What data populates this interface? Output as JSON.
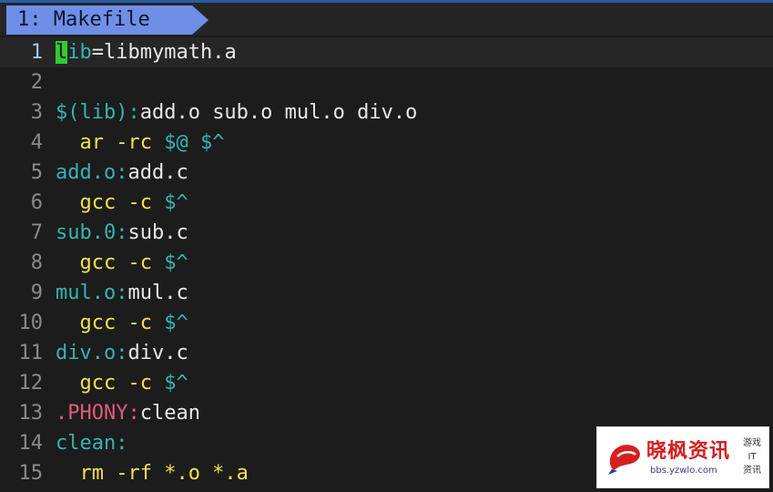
{
  "tab": {
    "label": "1: Makefile"
  },
  "colors": {
    "tab_active": "#6f8fe6",
    "cursor": "#2fcc2f",
    "target": "#36b3b3",
    "command": "#f2e24a",
    "phony": "#e05a7a",
    "default_text": "#e8e8e8"
  },
  "lines": [
    {
      "num": "1",
      "segments": [
        {
          "t": "l",
          "c": "cursor"
        },
        {
          "t": "ib",
          "c": "target"
        },
        {
          "t": "=libmymath.a",
          "c": "default"
        }
      ]
    },
    {
      "num": "2",
      "segments": []
    },
    {
      "num": "3",
      "segments": [
        {
          "t": "$(lib):",
          "c": "target"
        },
        {
          "t": "add.o sub.o mul.o div.o",
          "c": "default"
        }
      ]
    },
    {
      "num": "4",
      "segments": [
        {
          "t": "  ar -rc ",
          "c": "cmd"
        },
        {
          "t": "$@ $^",
          "c": "auto"
        }
      ]
    },
    {
      "num": "5",
      "segments": [
        {
          "t": "add.o:",
          "c": "target"
        },
        {
          "t": "add.c",
          "c": "default"
        }
      ]
    },
    {
      "num": "6",
      "segments": [
        {
          "t": "  gcc -c ",
          "c": "cmd"
        },
        {
          "t": "$^",
          "c": "auto"
        }
      ]
    },
    {
      "num": "7",
      "segments": [
        {
          "t": "sub.0:",
          "c": "target"
        },
        {
          "t": "sub.c",
          "c": "default"
        }
      ]
    },
    {
      "num": "8",
      "segments": [
        {
          "t": "  gcc -c ",
          "c": "cmd"
        },
        {
          "t": "$^",
          "c": "auto"
        }
      ]
    },
    {
      "num": "9",
      "segments": [
        {
          "t": "mul.o:",
          "c": "target"
        },
        {
          "t": "mul.c",
          "c": "default"
        }
      ]
    },
    {
      "num": "10",
      "segments": [
        {
          "t": "  gcc -c ",
          "c": "cmd"
        },
        {
          "t": "$^",
          "c": "auto"
        }
      ]
    },
    {
      "num": "11",
      "segments": [
        {
          "t": "div.o:",
          "c": "target"
        },
        {
          "t": "div.c",
          "c": "default"
        }
      ]
    },
    {
      "num": "12",
      "segments": [
        {
          "t": "  gcc -c ",
          "c": "cmd"
        },
        {
          "t": "$^",
          "c": "auto"
        }
      ]
    },
    {
      "num": "13",
      "segments": [
        {
          "t": ".PHONY:",
          "c": "phony"
        },
        {
          "t": "clean",
          "c": "default"
        }
      ]
    },
    {
      "num": "14",
      "segments": [
        {
          "t": "clean:",
          "c": "target"
        }
      ]
    },
    {
      "num": "15",
      "segments": [
        {
          "t": "  rm -rf *.o *.a",
          "c": "cmd"
        }
      ]
    }
  ],
  "watermark": {
    "main": "晓枫资讯",
    "url": "bbs.yzwlo.com",
    "side_lines": [
      "游戏",
      "IT",
      "资讯"
    ]
  }
}
